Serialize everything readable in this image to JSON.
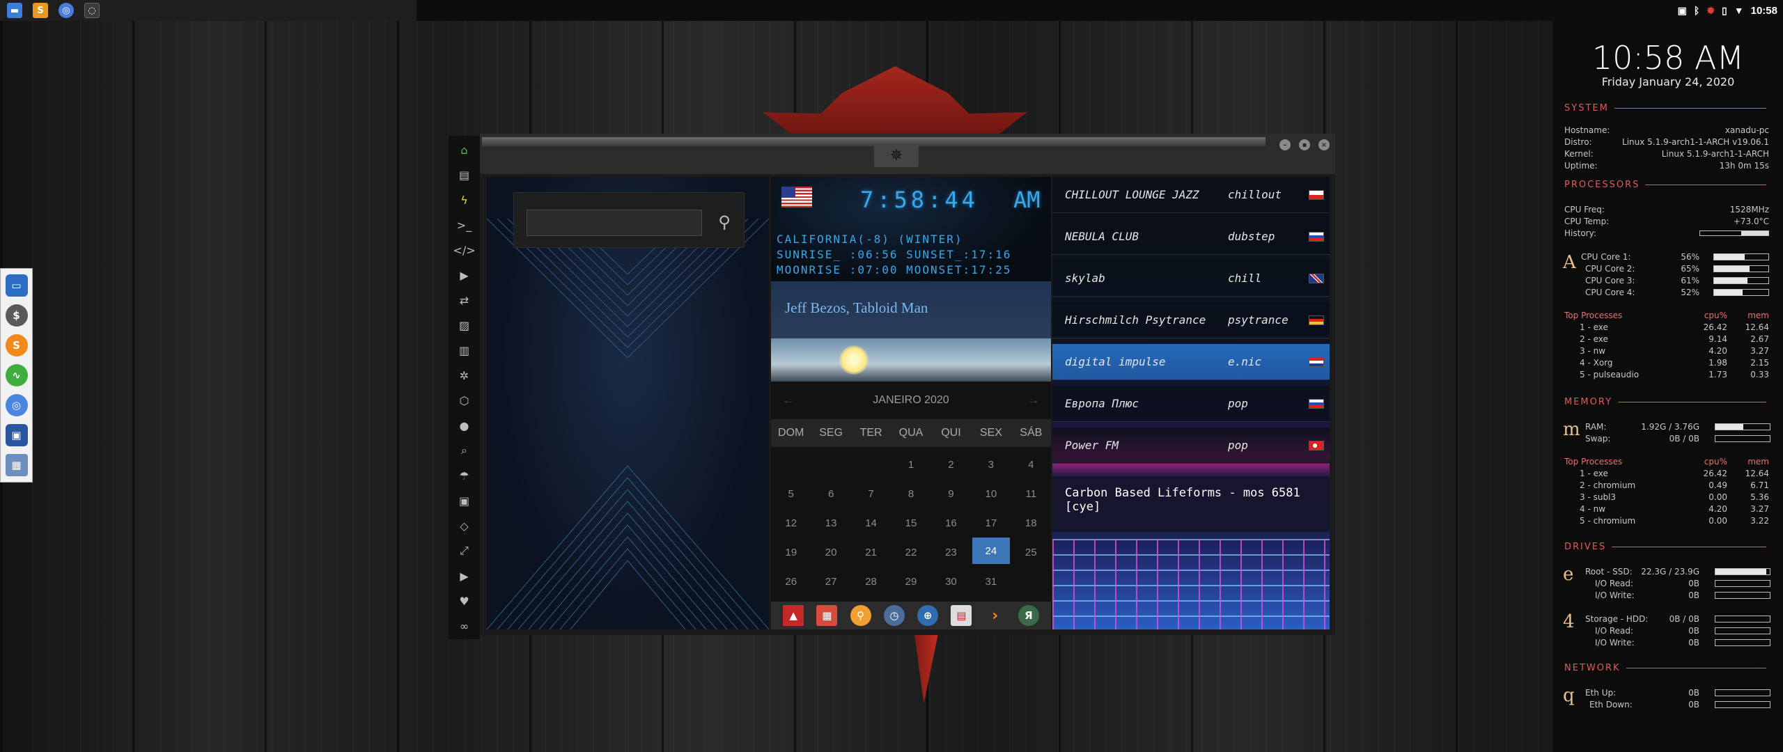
{
  "tray": {
    "clock": "10:58"
  },
  "search": {
    "placeholder": ""
  },
  "world_clock": {
    "time": "7:58:44",
    "ampm": "AM",
    "location": "CALIFORNIA(-8) (WINTER)",
    "sun": "SUNRISE_ :06:56 SUNSET_:17:16",
    "moon": "MOONRISE :07:00 MOONSET:17:25"
  },
  "headline": "Jeff Bezos, Tabloid Man",
  "calendar": {
    "month": "JANEIRO 2020",
    "daynames": [
      "DOM",
      "SEG",
      "TER",
      "QUA",
      "QUI",
      "SEX",
      "SÁB"
    ],
    "cells": [
      "",
      "",
      "",
      "1",
      "2",
      "3",
      "4",
      "5",
      "6",
      "7",
      "8",
      "9",
      "10",
      "11",
      "12",
      "13",
      "14",
      "15",
      "16",
      "17",
      "18",
      "19",
      "20",
      "21",
      "22",
      "23",
      "24",
      "25",
      "26",
      "27",
      "28",
      "29",
      "30",
      "31",
      ""
    ],
    "today": "24"
  },
  "radio": {
    "stations": [
      {
        "name": "CHILLOUT LOUNGE JAZZ",
        "genre": "chillout",
        "flag": "pl"
      },
      {
        "name": "NEBULA CLUB",
        "genre": "dubstep",
        "flag": "ru"
      },
      {
        "name": "skylab",
        "genre": "chill",
        "flag": "gb"
      },
      {
        "name": "Hirschmilch Psytrance",
        "genre": "psytrance",
        "flag": "de"
      },
      {
        "name": "digital impulse",
        "genre": "e.nic",
        "flag": "hr"
      },
      {
        "name": "Европа Плюс",
        "genre": "pop",
        "flag": "ru"
      },
      {
        "name": "Power FM",
        "genre": "pop",
        "flag": "tr"
      }
    ],
    "selected_index": 4,
    "now_playing": "Carbon Based Lifeforms - mos 6581 [cye]"
  },
  "conky": {
    "time": "10:58 AM",
    "date": "Friday January 24, 2020",
    "system": {
      "title": "SYSTEM",
      "rows": [
        {
          "k": "Hostname:",
          "v": "xanadu-pc"
        },
        {
          "k": "Distro:",
          "v": "Linux 5.1.9-arch1-1-ARCH v19.06.1"
        },
        {
          "k": "Kernel:",
          "v": "Linux 5.1.9-arch1-1-ARCH"
        },
        {
          "k": "Uptime:",
          "v": "13h 0m 15s"
        }
      ]
    },
    "processors": {
      "title": "PROCESSORS",
      "freq_k": "CPU Freq:",
      "freq_v": "1528MHz",
      "temp_k": "CPU Temp:",
      "temp_v": "+73.0°C",
      "history_k": "History:",
      "letter": "A",
      "cores": [
        {
          "k": "CPU Core 1:",
          "v": "56%",
          "pct": 56
        },
        {
          "k": "CPU Core 2:",
          "v": "65%",
          "pct": 65
        },
        {
          "k": "CPU Core 3:",
          "v": "61%",
          "pct": 61
        },
        {
          "k": "CPU Core 4:",
          "v": "52%",
          "pct": 52
        }
      ],
      "top_title": "Top Processes",
      "col_cpu": "cpu%",
      "col_mem": "mem",
      "top": [
        {
          "k": "1 - exe",
          "cpu": "26.42",
          "mem": "12.64"
        },
        {
          "k": "2 - exe",
          "cpu": "9.14",
          "mem": "2.67"
        },
        {
          "k": "3 - nw",
          "cpu": "4.20",
          "mem": "3.27"
        },
        {
          "k": "4 - Xorg",
          "cpu": "1.98",
          "mem": "2.15"
        },
        {
          "k": "5 - pulseaudio",
          "cpu": "1.73",
          "mem": "0.33"
        }
      ]
    },
    "memory": {
      "title": "MEMORY",
      "letter": "m",
      "ram_k": "RAM:",
      "ram_v": "1.92G / 3.76G",
      "ram_pct": 51,
      "swap_k": "Swap:",
      "swap_v": "0B / 0B",
      "swap_pct": 0,
      "top_title": "Top Processes",
      "col_cpu": "cpu%",
      "col_mem": "mem",
      "top": [
        {
          "k": "1 - exe",
          "cpu": "26.42",
          "mem": "12.64"
        },
        {
          "k": "2 - chromium",
          "cpu": "0.49",
          "mem": "6.71"
        },
        {
          "k": "3 - subl3",
          "cpu": "0.00",
          "mem": "5.36"
        },
        {
          "k": "4 - nw",
          "cpu": "4.20",
          "mem": "3.27"
        },
        {
          "k": "5 - chromium",
          "cpu": "0.00",
          "mem": "3.22"
        }
      ]
    },
    "drives": {
      "title": "DRIVES",
      "root_letter": "e",
      "root_k": "Root - SSD:",
      "root_v": "22.3G / 23.9G",
      "root_pct": 93,
      "read_k": "I/O Read:",
      "read_v": "0B",
      "write_k": "I/O Write:",
      "write_v": "0B",
      "storage_letter": "4",
      "storage_k": "Storage - HDD:",
      "storage_v": "0B / 0B",
      "storage_pct": 0,
      "sread_k": "I/O Read:",
      "sread_v": "0B",
      "swrite_k": "I/O Write:",
      "swrite_v": "0B"
    },
    "network": {
      "title": "NETWORK",
      "letter": "q",
      "up_k": "Eth Up:",
      "up_v": "0B",
      "down_k": "Eth Down:",
      "down_v": "0B"
    }
  }
}
